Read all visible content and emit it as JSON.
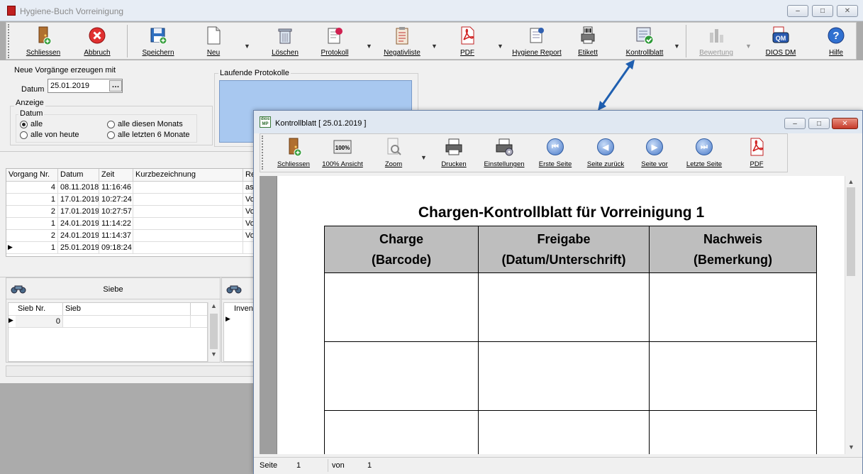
{
  "main_window": {
    "title": "Hygiene-Buch Vorreinigung",
    "caption_buttons": {
      "minimize": "–",
      "maximize": "□",
      "close": "✕"
    },
    "toolbar": [
      {
        "label": "Schliessen",
        "icon": "exit-door-icon"
      },
      {
        "label": "Abbruch",
        "icon": "cancel-icon"
      },
      {
        "label": "Speichern",
        "icon": "save-disk-icon"
      },
      {
        "label": "Neu",
        "icon": "new-document-icon"
      },
      {
        "label": "Löschen",
        "icon": "trash-icon"
      },
      {
        "label": "Protokoll",
        "icon": "protocol-pin-icon"
      },
      {
        "label": "Negativliste",
        "icon": "clipboard-list-icon"
      },
      {
        "label": "PDF",
        "icon": "pdf-icon"
      },
      {
        "label": "Hygiene Report",
        "icon": "report-icon"
      },
      {
        "label": "Etikett",
        "icon": "barcode-printer-icon"
      },
      {
        "label": "Kontrollblatt",
        "icon": "checklist-icon"
      },
      {
        "label": "Bewertung",
        "icon": "chart-icon"
      },
      {
        "label": "DIOS DM",
        "icon": "dios-dm-icon"
      },
      {
        "label": "Hilfe",
        "icon": "help-icon"
      }
    ]
  },
  "form": {
    "new_group_label": "Neue Vorgänge erzeugen mit",
    "datum_label": "Datum",
    "datum_value": "25.01.2019",
    "date_picker_button": "…",
    "anzeige_label": "Anzeige",
    "anzeige_datum_label": "Datum",
    "radios": [
      {
        "label": "alle",
        "checked": true
      },
      {
        "label": "alle diesen Monats",
        "checked": false
      },
      {
        "label": "alle von heute",
        "checked": false
      },
      {
        "label": "alle letzten 6 Monate",
        "checked": false
      }
    ],
    "laufende_label": "Laufende Protokolle"
  },
  "vorgang_table": {
    "headers": [
      "Vorgang Nr.",
      "Datum",
      "Zeit",
      "Kurzbezeichnung",
      "Re"
    ],
    "rows": [
      [
        "4",
        "08.11.2018",
        "11:16:46",
        "",
        "as"
      ],
      [
        "1",
        "17.01.2019",
        "10:27:24",
        "",
        "Vo"
      ],
      [
        "2",
        "17.01.2019",
        "10:27:57",
        "",
        "Vo"
      ],
      [
        "1",
        "24.01.2019",
        "11:14:22",
        "",
        "Vo"
      ],
      [
        "2",
        "24.01.2019",
        "11:14:37",
        "",
        "Vo"
      ],
      [
        "1",
        "25.01.2019",
        "09:18:24",
        "",
        ""
      ]
    ],
    "current_row_marker": "▶"
  },
  "siebe_panel": {
    "title": "Siebe",
    "headers": [
      "Sieb Nr.",
      "Sieb"
    ],
    "rows": [
      [
        "0",
        ""
      ]
    ],
    "scroll_up": "▲",
    "scroll_down": "▼"
  },
  "inventar_panel": {
    "header_partial": "Inven"
  },
  "dialog": {
    "logo_text": "dios MP",
    "title": "Kontrollblatt [ 25.01.2019 ]",
    "toolbar": [
      {
        "label": "Schliessen",
        "icon": "exit-door-icon"
      },
      {
        "label": "100% Ansicht",
        "icon": "zoom-100-icon"
      },
      {
        "label": "Zoom",
        "icon": "zoom-icon"
      },
      {
        "label": "Drucken",
        "icon": "printer-icon"
      },
      {
        "label": "Einstellungen",
        "icon": "printer-settings-icon"
      },
      {
        "label": "Erste Seite",
        "icon": "first-page-icon"
      },
      {
        "label": "Seite zurück",
        "icon": "previous-page-icon"
      },
      {
        "label": "Seite vor",
        "icon": "next-page-icon"
      },
      {
        "label": "Letzte Seite",
        "icon": "last-page-icon"
      },
      {
        "label": "PDF",
        "icon": "pdf-icon"
      }
    ],
    "document": {
      "title": "Chargen-Kontrollblatt für Vorreinigung 1",
      "columns": [
        {
          "line1": "Charge",
          "line2": "(Barcode)"
        },
        {
          "line1": "Freigabe",
          "line2": "(Datum/Unterschrift)"
        },
        {
          "line1": "Nachweis",
          "line2": "(Bemerkung)"
        }
      ]
    },
    "status": {
      "seite_label": "Seite",
      "seite_value": "1",
      "von_label": "von",
      "von_value": "1"
    }
  },
  "colors": {
    "accent_arrow": "#1f5fb0",
    "table_header": "#bebebe",
    "selection_blue": "#a8c8f0"
  }
}
